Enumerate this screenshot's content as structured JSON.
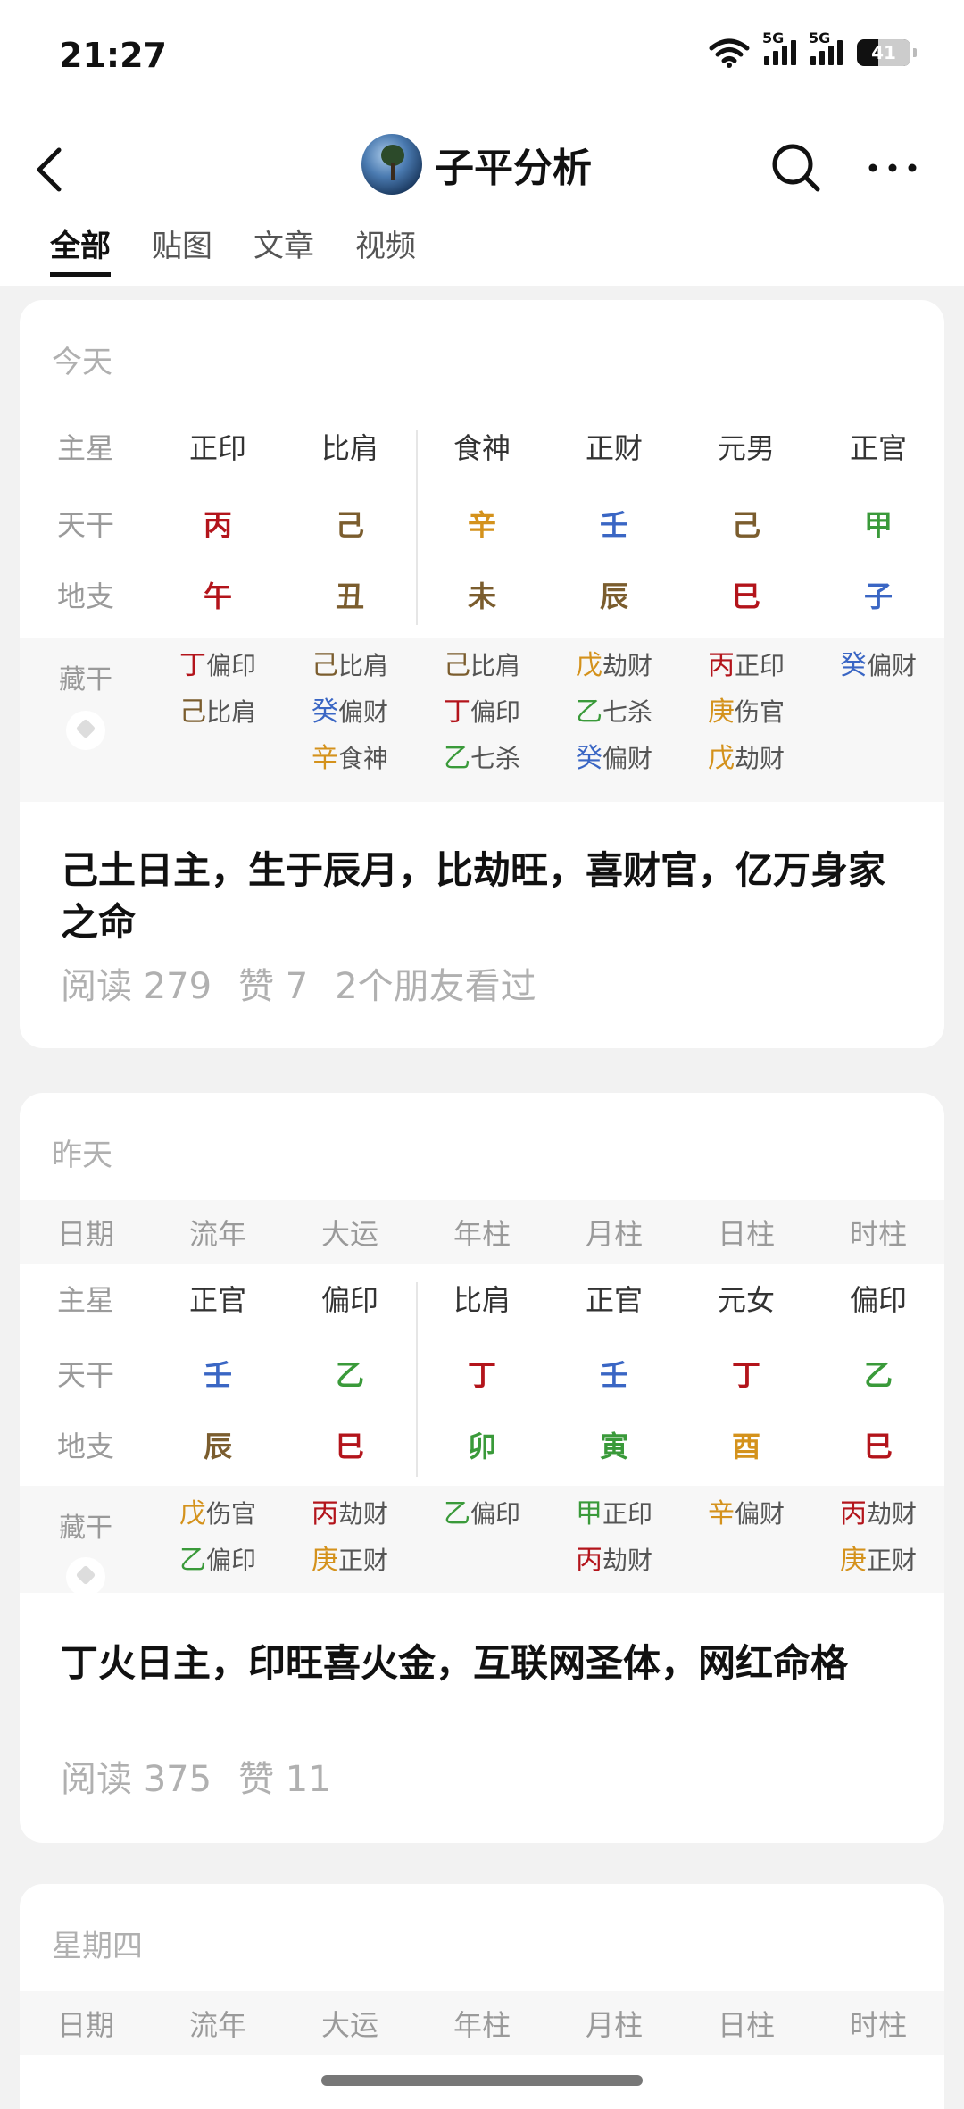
{
  "status": {
    "time": "21:27",
    "net1": "5G",
    "net2": "5G",
    "battery": "41"
  },
  "nav": {
    "title": "子平分析",
    "back_icon": "chevron-left-icon",
    "search_icon": "search-icon",
    "more_icon": "more-icon"
  },
  "tabs": [
    "全部",
    "贴图",
    "文章",
    "视频"
  ],
  "colors": {
    "fire": "#b3141b",
    "earth": "#7b5d2e",
    "metal": "#d4921c",
    "water": "#3a66c4",
    "wood": "#3a9a3a"
  },
  "cards": [
    {
      "date": "今天",
      "labels": {
        "zhuxing": "主星",
        "tiangan": "天干",
        "dizhi": "地支",
        "canggan": "藏干"
      },
      "zhuxing": [
        "正印",
        "比肩",
        "食神",
        "正财",
        "元男",
        "正官"
      ],
      "tiangan": [
        "丙",
        "己",
        "辛",
        "壬",
        "己",
        "甲"
      ],
      "dizhi": [
        "午",
        "丑",
        "未",
        "辰",
        "巳",
        "子"
      ],
      "canggan": [
        [
          [
            "丁",
            "偏印"
          ],
          [
            "己",
            "比肩"
          ]
        ],
        [
          [
            "己",
            "比肩"
          ],
          [
            "癸",
            "偏财"
          ],
          [
            "辛",
            "食神"
          ]
        ],
        [
          [
            "己",
            "比肩"
          ],
          [
            "丁",
            "偏印"
          ],
          [
            "乙",
            "七杀"
          ]
        ],
        [
          [
            "戊",
            "劫财"
          ],
          [
            "乙",
            "七杀"
          ],
          [
            "癸",
            "偏财"
          ]
        ],
        [
          [
            "丙",
            "正印"
          ],
          [
            "庚",
            "伤官"
          ],
          [
            "戊",
            "劫财"
          ]
        ],
        [
          [
            "癸",
            "偏财"
          ]
        ]
      ],
      "caption": "己土日主，生于辰月，比劫旺，喜财官，亿万身家之命",
      "stats": [
        "阅读 279",
        "赞 7",
        "2个朋友看过"
      ]
    },
    {
      "date": "昨天",
      "header": [
        "日期",
        "流年",
        "大运",
        "年柱",
        "月柱",
        "日柱",
        "时柱"
      ],
      "labels": {
        "zhuxing": "主星",
        "tiangan": "天干",
        "dizhi": "地支",
        "canggan": "藏干"
      },
      "zhuxing": [
        "正官",
        "偏印",
        "比肩",
        "正官",
        "元女",
        "偏印"
      ],
      "tiangan": [
        "壬",
        "乙",
        "丁",
        "壬",
        "丁",
        "乙"
      ],
      "dizhi": [
        "辰",
        "巳",
        "卯",
        "寅",
        "酉",
        "巳"
      ],
      "canggan": [
        [
          [
            "戊",
            "伤官"
          ],
          [
            "乙",
            "偏印"
          ]
        ],
        [
          [
            "丙",
            "劫财"
          ],
          [
            "庚",
            "正财"
          ]
        ],
        [
          [
            "乙",
            "偏印"
          ]
        ],
        [
          [
            "甲",
            "正印"
          ],
          [
            "丙",
            "劫财"
          ]
        ],
        [
          [
            "辛",
            "偏财"
          ]
        ],
        [
          [
            "丙",
            "劫财"
          ],
          [
            "庚",
            "正财"
          ]
        ]
      ],
      "caption": "丁火日主，印旺喜火金，互联网圣体，网红命格",
      "stats": [
        "阅读 375",
        "赞 11"
      ]
    },
    {
      "date": "星期四",
      "header": [
        "日期",
        "流年",
        "大运",
        "年柱",
        "月柱",
        "日柱",
        "时柱"
      ]
    }
  ]
}
